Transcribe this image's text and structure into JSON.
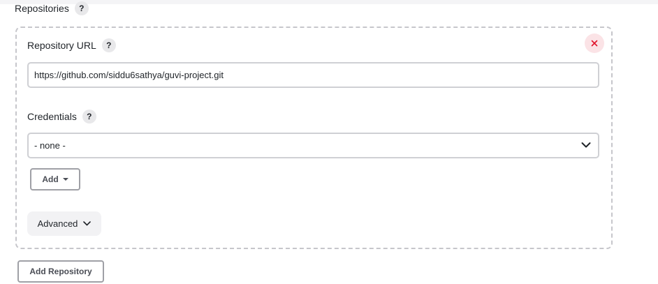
{
  "section": {
    "title": "Repositories",
    "help": "?"
  },
  "repository": {
    "url_label": "Repository URL",
    "url_help": "?",
    "url_value": "https://github.com/siddu6sathya/guvi-project.git",
    "credentials_label": "Credentials",
    "credentials_help": "?",
    "credentials_selected": "- none -",
    "add_label": "Add",
    "advanced_label": "Advanced",
    "remove_icon": "close-icon"
  },
  "footer": {
    "add_repository_label": "Add Repository"
  },
  "colors": {
    "remove_accent": "#e0152c",
    "dashed_border": "#c6c6cb",
    "help_bg": "#e8e8ea"
  }
}
